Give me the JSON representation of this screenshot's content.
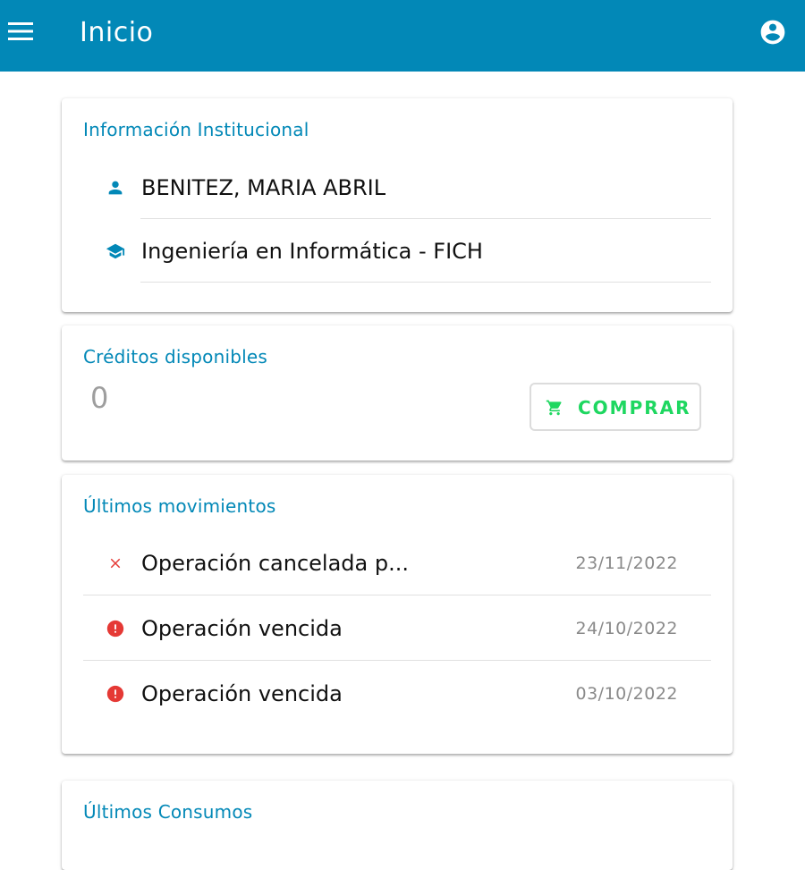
{
  "header": {
    "title": "Inicio",
    "menu_icon": "menu-icon",
    "account_icon": "account-circle-icon",
    "background": "#0288b7"
  },
  "institutional": {
    "title": "Información Institucional",
    "name": "BENITEZ, MARIA ABRIL",
    "name_icon": "person-icon",
    "career": "Ingeniería en Informática - FICH",
    "career_icon": "school-icon"
  },
  "credits": {
    "title": "Créditos disponibles",
    "value": "0",
    "buy_label": "COMPRAR",
    "buy_icon": "cart-icon",
    "buy_color": "#1ed760"
  },
  "movements": {
    "title": "Últimos movimientos",
    "items": [
      {
        "text": "Operación cancelada p...",
        "date": "23/11/2022",
        "icon": "close-icon",
        "icon_color": "#e53935"
      },
      {
        "text": "Operación vencida",
        "date": "24/10/2022",
        "icon": "alert-circle-icon",
        "icon_color": "#e53935"
      },
      {
        "text": "Operación vencida",
        "date": "03/10/2022",
        "icon": "alert-circle-icon",
        "icon_color": "#e53935"
      }
    ]
  },
  "consumptions": {
    "title": "Últimos Consumos"
  }
}
